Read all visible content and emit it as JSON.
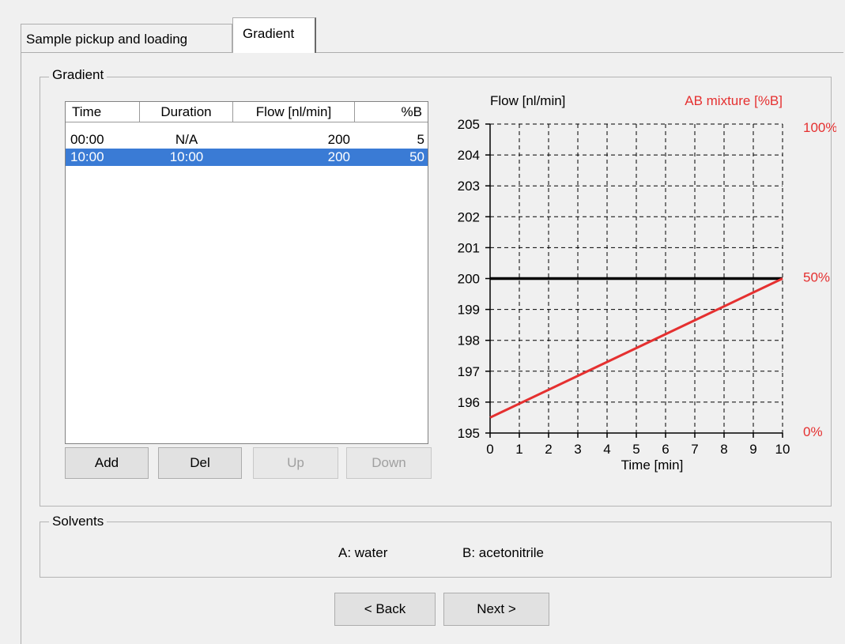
{
  "tabs": [
    {
      "label": "Sample pickup and loading",
      "active": false
    },
    {
      "label": "Gradient",
      "active": true
    }
  ],
  "gradient_group": {
    "label": "Gradient",
    "table": {
      "columns": [
        "Time",
        "Duration",
        "Flow [nl/min]",
        "%B"
      ],
      "rows": [
        {
          "time": "00:00",
          "duration": "N/A",
          "flow": "200",
          "b": "5",
          "selected": false
        },
        {
          "time": "10:00",
          "duration": "10:00",
          "flow": "200",
          "b": "50",
          "selected": true
        }
      ]
    },
    "buttons": {
      "add": "Add",
      "del": "Del",
      "up": "Up",
      "down": "Down"
    }
  },
  "chart_data": {
    "type": "line",
    "left_axis_title": "Flow [nl/min]",
    "right_axis_title": "AB mixture [%B]",
    "xlabel": "Time [min]",
    "xlim": [
      0,
      10
    ],
    "ylim_left": [
      195,
      205
    ],
    "ylim_right": [
      0,
      100
    ],
    "x_ticks": [
      "0",
      "1",
      "2",
      "3",
      "4",
      "5",
      "6",
      "7",
      "8",
      "9",
      "10"
    ],
    "y_left_ticks": [
      "195",
      "196",
      "197",
      "198",
      "199",
      "200",
      "201",
      "202",
      "203",
      "204",
      "205"
    ],
    "y_right_ticks": [
      "0%",
      "50%",
      "100%"
    ],
    "grid": true,
    "series": [
      {
        "name": "Flow [nl/min]",
        "axis": "left",
        "color": "#000000",
        "x": [
          0,
          10
        ],
        "y": [
          200,
          200
        ]
      },
      {
        "name": "AB mixture [%B]",
        "axis": "right",
        "color": "#e53030",
        "x": [
          0,
          10
        ],
        "y": [
          5,
          50
        ]
      }
    ],
    "colors": {
      "right_axis": "#e53030"
    }
  },
  "solvents_group": {
    "label": "Solvents",
    "a": "A: water",
    "b": "B: acetonitrile"
  },
  "nav": {
    "back": "< Back",
    "next": "Next >"
  }
}
